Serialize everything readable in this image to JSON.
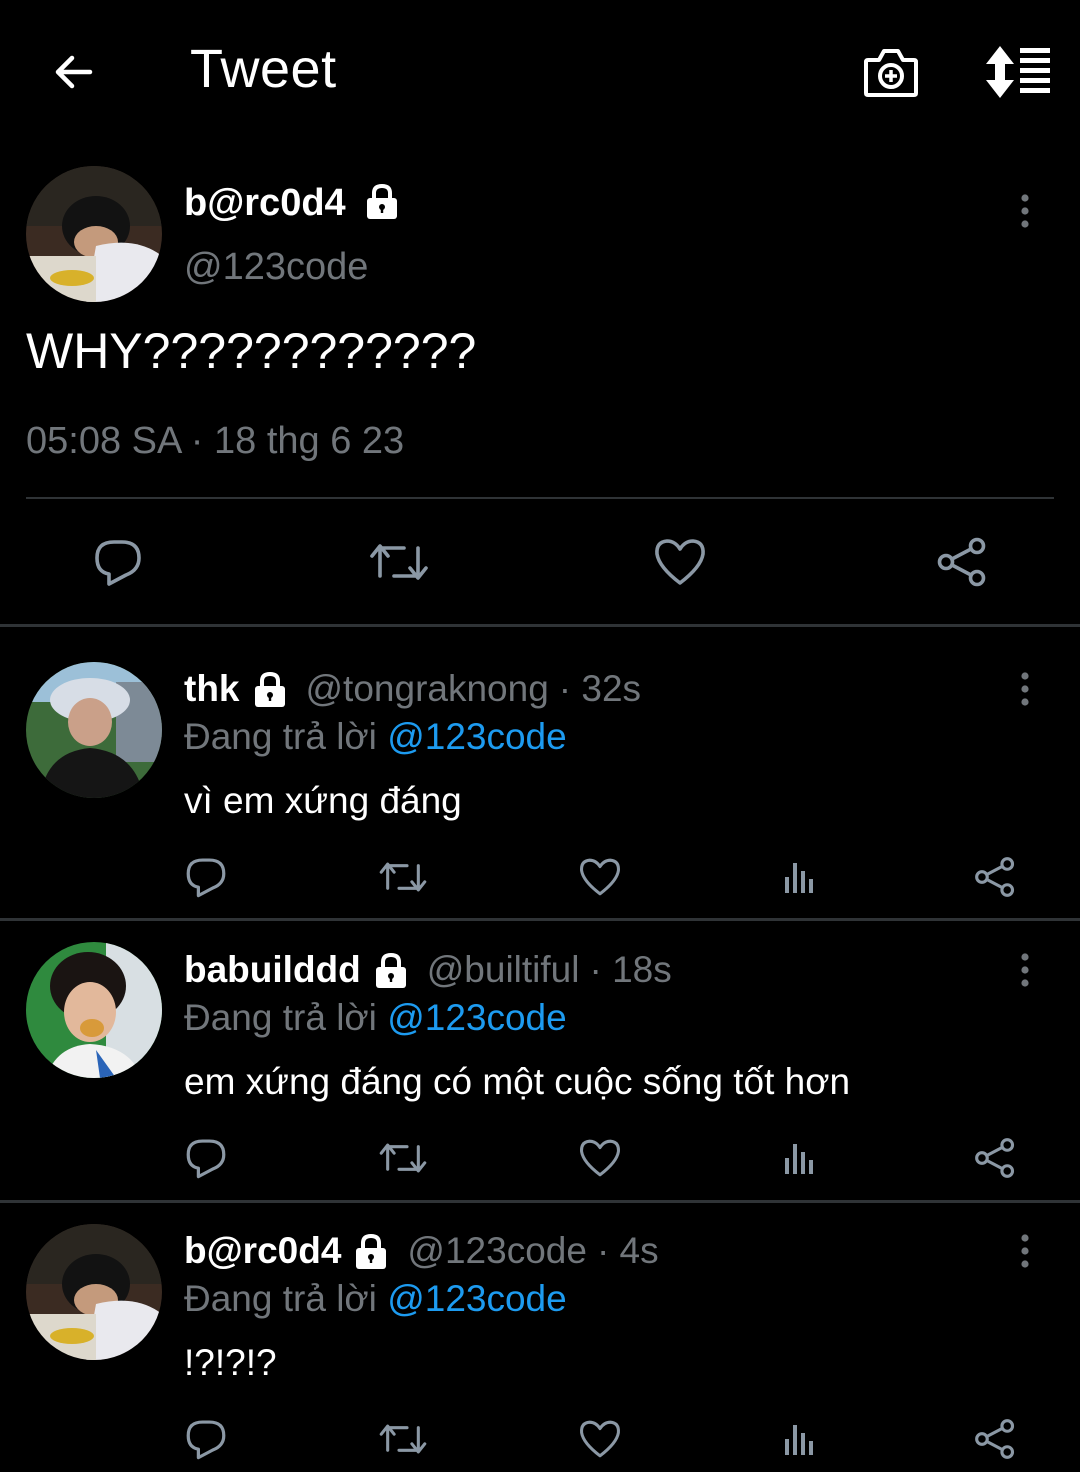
{
  "header": {
    "title": "Tweet",
    "icons": [
      "back-arrow-icon",
      "camera-plus-icon",
      "sort-icon"
    ]
  },
  "main_tweet": {
    "display_name": "b@rc0d4",
    "handle": "@123code",
    "text": "WHY????????????",
    "timestamp": "05:08 SA · 18 thg 6 23",
    "actions": [
      "reply-icon",
      "retweet-icon",
      "like-icon",
      "share-icon"
    ]
  },
  "replies": [
    {
      "display_name": "thk",
      "handle": "@tongraknong",
      "time": "· 32s",
      "replying_prefix": "Đang trả lời",
      "replying_to": "@123code",
      "text": "vì em xứng đáng"
    },
    {
      "display_name": "babuilddd",
      "handle": "@builtiful",
      "time": "· 18s",
      "replying_prefix": "Đang trả lời",
      "replying_to": "@123code",
      "text": "em xứng đáng có một cuộc sống tốt hơn"
    },
    {
      "display_name": "b@rc0d4",
      "handle": "@123code",
      "time": "· 4s",
      "replying_prefix": "Đang trả lời",
      "replying_to": "@123code",
      "text": "!?!?!?"
    }
  ],
  "colors": {
    "background": "#000000",
    "text": "#ffffff",
    "secondary": "#71767b",
    "accent": "#1d9bf0",
    "divider": "#2f3336"
  }
}
